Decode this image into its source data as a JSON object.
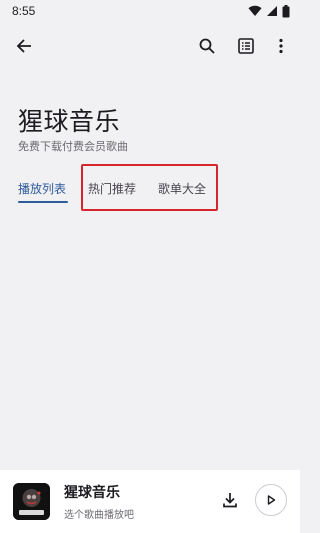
{
  "status_bar": {
    "time": "8:55"
  },
  "header": {
    "title": "猩球音乐",
    "subtitle": "免费下载付费会员歌曲"
  },
  "tabs": [
    {
      "label": "播放列表",
      "active": true
    },
    {
      "label": "热门推荐",
      "active": false
    },
    {
      "label": "歌单大全",
      "active": false
    }
  ],
  "player": {
    "title": "猩球音乐",
    "subtitle": "选个歌曲播放吧",
    "art_text": "猩球音乐"
  },
  "colors": {
    "accent": "#2e5b9a",
    "highlight": "#d6262b",
    "background": "#f1f0f2"
  }
}
